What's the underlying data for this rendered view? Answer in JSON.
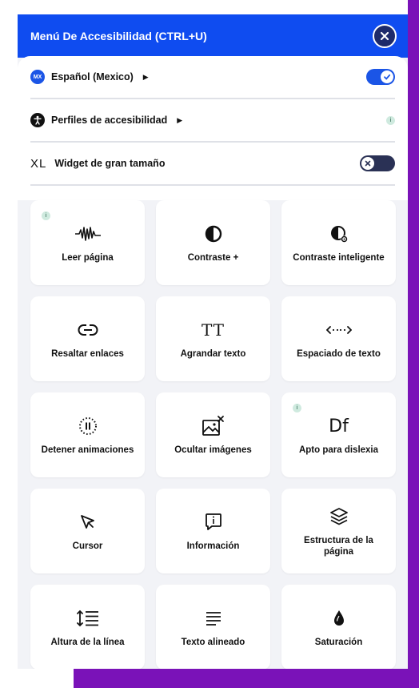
{
  "header": {
    "title": "Menú De Accesibilidad (CTRL+U)"
  },
  "settings": {
    "language": {
      "flag": "MX",
      "label": "Español (Mexico)",
      "toggle": true
    },
    "profiles": {
      "label": "Perfiles de accesibilidad",
      "info": "i"
    },
    "widget": {
      "prefix": "XL",
      "label": "Widget de gran tamaño",
      "toggle": false
    }
  },
  "tiles": [
    {
      "label": "Leer página",
      "icon": "waveform-icon",
      "info": "i"
    },
    {
      "label": "Contraste +",
      "icon": "contrast-icon"
    },
    {
      "label": "Contraste inteligente",
      "icon": "smart-contrast-icon"
    },
    {
      "label": "Resaltar enlaces",
      "icon": "link-icon"
    },
    {
      "label": "Agrandar texto",
      "icon": "text-size-icon",
      "glyph": "TT"
    },
    {
      "label": "Espaciado de texto",
      "icon": "spacing-icon"
    },
    {
      "label": "Detener animaciones",
      "icon": "pause-icon"
    },
    {
      "label": "Ocultar imágenes",
      "icon": "hide-image-icon"
    },
    {
      "label": "Apto para dislexia",
      "icon": "dyslexia-icon",
      "glyph": "Df",
      "info": "i"
    },
    {
      "label": "Cursor",
      "icon": "cursor-icon"
    },
    {
      "label": "Información",
      "icon": "info-bubble-icon"
    },
    {
      "label": "Estructura de la página",
      "icon": "layers-icon"
    },
    {
      "label": "Altura de la línea",
      "icon": "line-height-icon"
    },
    {
      "label": "Texto alineado",
      "icon": "align-icon"
    },
    {
      "label": "Saturación",
      "icon": "droplet-icon"
    }
  ],
  "colors": {
    "accent": "#0f4cf0",
    "purple": "#7a12b8",
    "panel_bg": "#f2f3f7"
  }
}
